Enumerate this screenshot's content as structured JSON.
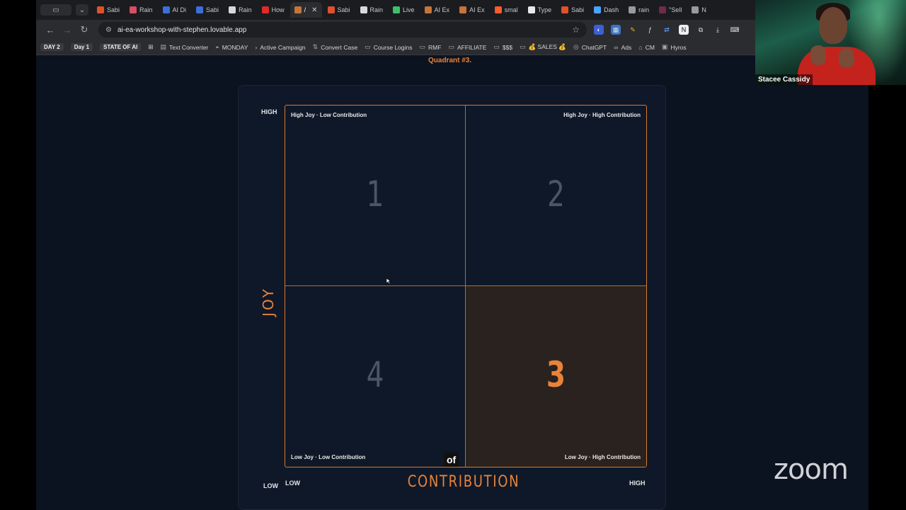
{
  "browser": {
    "tabs": [
      {
        "label": "Sabi",
        "color": "#e0512b",
        "active": false
      },
      {
        "label": "Rain",
        "color": "#d94d67",
        "active": false
      },
      {
        "label": "AI Di",
        "color": "#3b6fd9",
        "active": false
      },
      {
        "label": "Sabi",
        "color": "#3b6fd9",
        "active": false
      },
      {
        "label": "Rain",
        "color": "#d9d9d9",
        "active": false
      },
      {
        "label": "How",
        "color": "#e02a2a",
        "active": false
      },
      {
        "label": "/",
        "color": "#c6743a",
        "active": true
      },
      {
        "label": "Sabi",
        "color": "#e0512b",
        "active": false
      },
      {
        "label": "Rain",
        "color": "#d9d9d9",
        "active": false
      },
      {
        "label": "Live",
        "color": "#3fbf6b",
        "active": false
      },
      {
        "label": "AI Ex",
        "color": "#c6743a",
        "active": false
      },
      {
        "label": "AI Ex",
        "color": "#c6743a",
        "active": false
      },
      {
        "label": "smal",
        "color": "#ff5a2b",
        "active": false
      },
      {
        "label": "Type",
        "color": "#e8e8e8",
        "active": false
      },
      {
        "label": "Sabi",
        "color": "#e0512b",
        "active": false
      },
      {
        "label": "Dash",
        "color": "#4aa3ff",
        "active": false
      },
      {
        "label": "rain",
        "color": "#9a9a9a",
        "active": false
      },
      {
        "label": "\"Sell",
        "color": "#6e2c4a",
        "active": false
      },
      {
        "label": "N",
        "color": "#9a9a9a",
        "active": false
      }
    ],
    "url": "ai-ea-workshop-with-stephen.lovable.app",
    "bookmarks": [
      {
        "label": "DAY 2",
        "type": "pill"
      },
      {
        "label": "Day 1",
        "type": "pill"
      },
      {
        "label": "STATE OF AI",
        "type": "pill"
      },
      {
        "label": "Text Converter",
        "icon": "▤"
      },
      {
        "label": "MONDAY",
        "icon": "◓"
      },
      {
        "label": "Active Campaign",
        "icon": "›"
      },
      {
        "label": "Convert Case",
        "icon": "⇅"
      },
      {
        "label": "Course Logins",
        "icon": "▭"
      },
      {
        "label": "RMF",
        "icon": "▭"
      },
      {
        "label": "AFFILIATE",
        "icon": "▭"
      },
      {
        "label": "$$$",
        "icon": "▭"
      },
      {
        "label": "💰 SALES 💰",
        "icon": "▭"
      },
      {
        "label": "ChatGPT",
        "icon": "◎"
      },
      {
        "label": "Ads",
        "icon": "∞"
      },
      {
        "label": "CM",
        "icon": "⌂"
      },
      {
        "label": "Hyros",
        "icon": "▣"
      }
    ]
  },
  "page": {
    "caption_top": "Quadrant #3.",
    "quadrants": {
      "q1": {
        "label": "High Joy · Low Contribution",
        "number": "1"
      },
      "q2": {
        "label": "High Joy · High Contribution",
        "number": "2"
      },
      "q3": {
        "label": "Low Joy · High Contribution",
        "number": "3"
      },
      "q4": {
        "label": "Low Joy · Low Contribution",
        "number": "4"
      }
    },
    "axes": {
      "y_title": "JOY",
      "y_high": "HIGH",
      "y_low": "LOW",
      "x_title": "CONTRIBUTION",
      "x_low": "LOW",
      "x_high": "HIGH"
    },
    "live_caption": "of"
  },
  "zoom": {
    "participant_name": "Stacee Cassidy",
    "logo": "zoom"
  }
}
